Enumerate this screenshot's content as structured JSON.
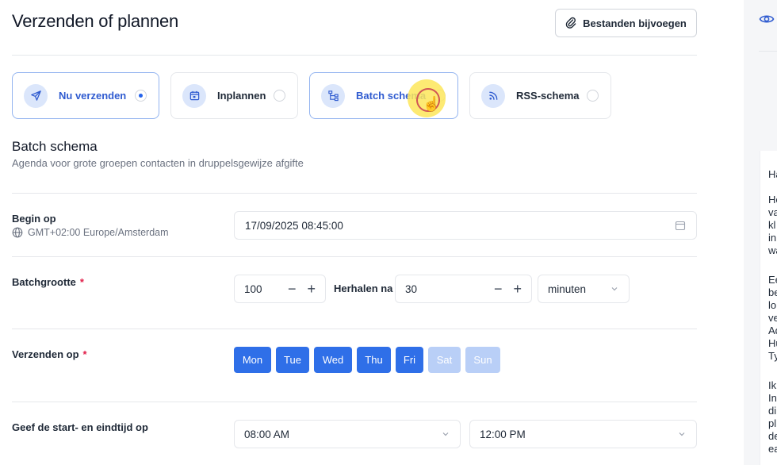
{
  "header": {
    "title": "Verzenden of plannen",
    "attach_label": "Bestanden bijvoegen"
  },
  "modes": [
    {
      "label": "Nu verzenden",
      "icon": "send-icon",
      "radio_on": true
    },
    {
      "label": "Inplannen",
      "icon": "calendar-icon",
      "radio_on": false
    },
    {
      "label": "Batch schema",
      "icon": "tree-icon",
      "radio_on": false
    },
    {
      "label": "RSS-schema",
      "icon": "rss-icon",
      "radio_on": false
    }
  ],
  "section": {
    "title": "Batch schema",
    "subtitle": "Agenda voor grote groepen contacten in druppelsgewijze afgifte"
  },
  "begin": {
    "label": "Begin op",
    "timezone": "GMT+02:00 Europe/Amsterdam",
    "value": "17/09/2025 08:45:00"
  },
  "batch": {
    "label": "Batchgrootte",
    "required": "*",
    "size_value": "100",
    "repeat_label": "Herhalen na",
    "repeat_value": "30",
    "unit": "minuten",
    "minus": "−",
    "plus": "+"
  },
  "send_on": {
    "label": "Verzenden op",
    "required": "*",
    "days": [
      {
        "label": "Mon",
        "active": true
      },
      {
        "label": "Tue",
        "active": true
      },
      {
        "label": "Wed",
        "active": true
      },
      {
        "label": "Thu",
        "active": true
      },
      {
        "label": "Fri",
        "active": true
      },
      {
        "label": "Sat",
        "active": false
      },
      {
        "label": "Sun",
        "active": false
      }
    ]
  },
  "time_window": {
    "label": "Geef de start- en eindtijd op",
    "start": "08:00 AM",
    "end": "12:00 PM"
  },
  "preview_fragments": [
    "Ha",
    "He",
    "va",
    "kl",
    "in",
    "wa",
    "Ee",
    "be",
    "lo",
    "ve",
    "Ad",
    "Hu",
    "Ty",
    "Ik",
    "In",
    "di",
    "pl",
    "de",
    "ea"
  ],
  "colors": {
    "accent": "#2f6fe8",
    "accent_disabled": "#b9cff7",
    "selected_label": "#2f5bd0",
    "required": "#e11d48"
  }
}
